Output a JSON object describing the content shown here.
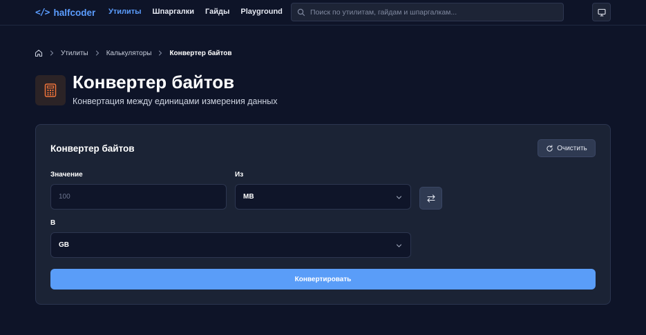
{
  "header": {
    "logo_glyph": "</>",
    "logo_text": "halfcoder",
    "nav": [
      "Утилиты",
      "Шпаргалки",
      "Гайды",
      "Playground"
    ],
    "active_nav": "Утилиты",
    "search_placeholder": "Поиск по утилитам, гайдам и шпаргалкам...",
    "accent_color": "#5b9dff"
  },
  "breadcrumb": {
    "items": [
      "Утилиты",
      "Калькуляторы"
    ],
    "current": "Конвертер байтов"
  },
  "page": {
    "title": "Конвертер байтов",
    "subtitle": "Конвертация между единицами измерения данных",
    "icon": "calculator-icon"
  },
  "card": {
    "title": "Конвертер байтов",
    "clear_label": "Очистить",
    "value_label": "Значение",
    "value_placeholder": "100",
    "from_label": "Из",
    "from_value": "MB",
    "to_label": "В",
    "to_value": "GB",
    "convert_label": "Конвертировать",
    "button_color": "#5a9df8"
  }
}
